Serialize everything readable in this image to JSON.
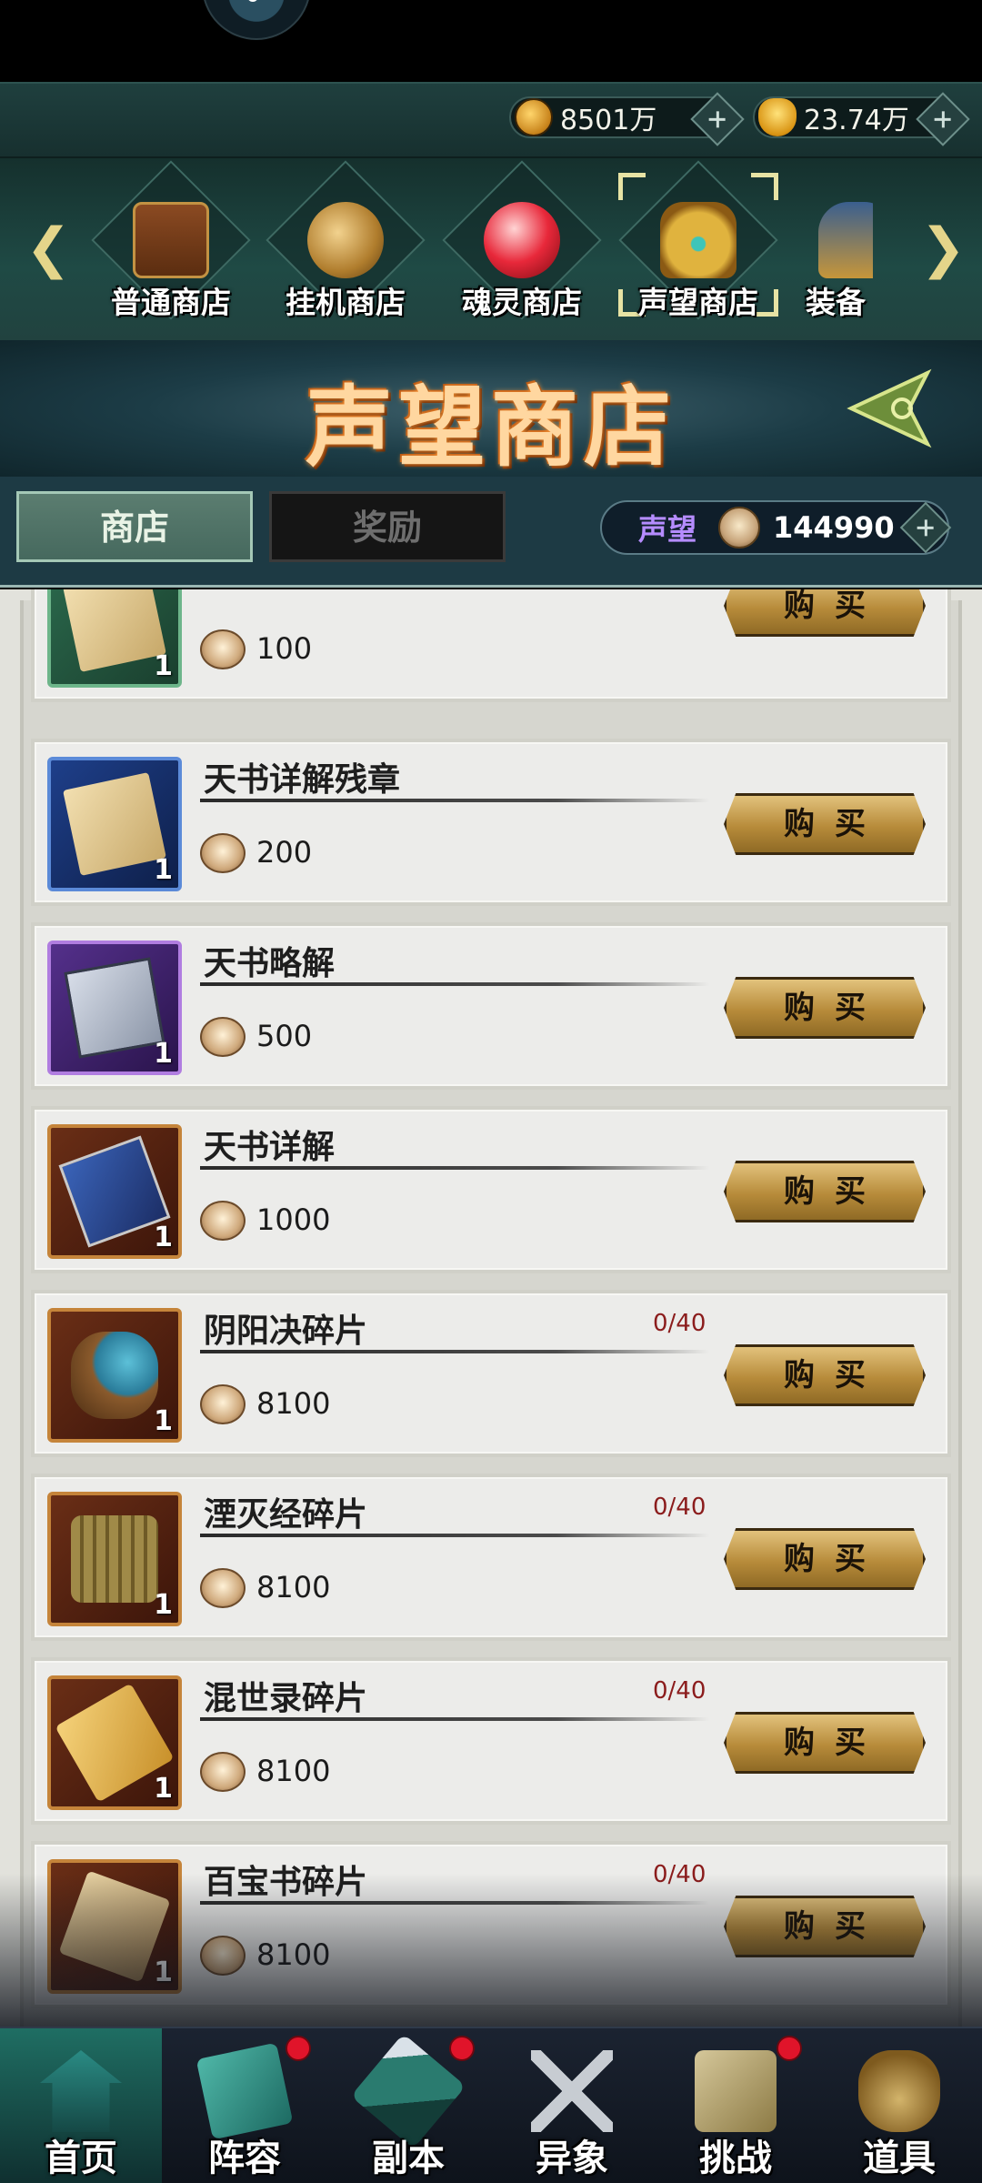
{
  "currency": {
    "coins": "8501万",
    "ingots": "23.74万"
  },
  "shop_tabs": [
    {
      "label": "普通商店",
      "icon": "chest-icon",
      "selected": false
    },
    {
      "label": "挂机商店",
      "icon": "medal-icon",
      "selected": false
    },
    {
      "label": "魂灵商店",
      "icon": "soul-orb-icon",
      "selected": false
    },
    {
      "label": "声望商店",
      "icon": "crown-icon",
      "selected": true
    },
    {
      "label": "装备",
      "icon": "helmet-icon",
      "selected": false
    }
  ],
  "banner": {
    "title": "声望商店"
  },
  "subtabs": {
    "shop": "商店",
    "rewards": "奖励"
  },
  "reputation": {
    "label": "声望",
    "value": "144990"
  },
  "items": [
    {
      "name": "",
      "price": "100",
      "qty": "1",
      "limit": "",
      "rarity": "green",
      "art": "scroll"
    },
    {
      "name": "天书详解残章",
      "price": "200",
      "qty": "1",
      "limit": "",
      "rarity": "blue",
      "art": "scroll"
    },
    {
      "name": "天书略解",
      "price": "500",
      "qty": "1",
      "limit": "",
      "rarity": "purple",
      "art": "book"
    },
    {
      "name": "天书详解",
      "price": "1000",
      "qty": "1",
      "limit": "",
      "rarity": "orange",
      "art": "blue-book"
    },
    {
      "name": "阴阳决碎片",
      "price": "8100",
      "qty": "1",
      "limit": "0/40",
      "rarity": "orange",
      "art": "pouch"
    },
    {
      "name": "湮灭经碎片",
      "price": "8100",
      "qty": "1",
      "limit": "0/40",
      "rarity": "orange",
      "art": "bamboo"
    },
    {
      "name": "混世录碎片",
      "price": "8100",
      "qty": "1",
      "limit": "0/40",
      "rarity": "orange",
      "art": "yellow-scroll"
    },
    {
      "name": "百宝书碎片",
      "price": "8100",
      "qty": "1",
      "limit": "0/40",
      "rarity": "orange",
      "art": "tan-scroll"
    }
  ],
  "buy_label": "购买",
  "bottom_nav": [
    {
      "label": "首页",
      "icon": "home-icon",
      "badge": false
    },
    {
      "label": "阵容",
      "icon": "lineup-icon",
      "badge": true
    },
    {
      "label": "副本",
      "icon": "dungeon-icon",
      "badge": true
    },
    {
      "label": "异象",
      "icon": "crossed-swords-icon",
      "badge": false
    },
    {
      "label": "挑战",
      "icon": "challenge-icon",
      "badge": true
    },
    {
      "label": "道具",
      "icon": "item-bag-icon",
      "badge": false
    }
  ],
  "colors": {
    "accent_gold": "#b78b3a",
    "limit_red": "#8b1c1c",
    "reputation_purple": "#b58cff",
    "badge_red": "#e0142a"
  }
}
